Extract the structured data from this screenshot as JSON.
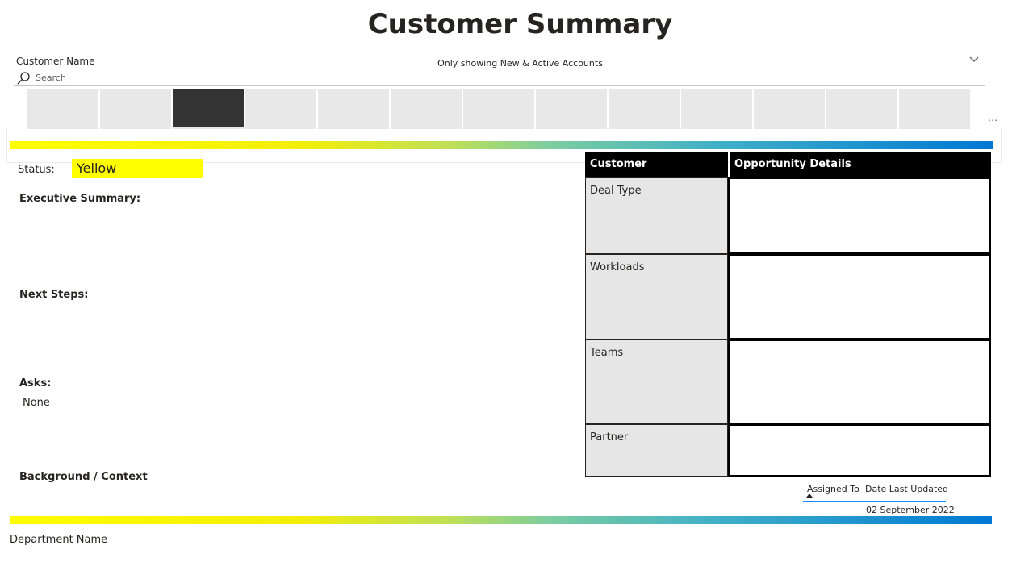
{
  "page": {
    "title": "Customer Summary",
    "department": "Department Name"
  },
  "slicer": {
    "label": "Customer Name",
    "search_placeholder": "Search",
    "filter_note": "Only showing New & Active Accounts",
    "selected_index": 2,
    "tile_count": 13
  },
  "status": {
    "label": "Status:",
    "value": "Yellow",
    "color": "#ffff00"
  },
  "sections": {
    "executive_summary": "Executive Summary:",
    "next_steps": "Next Steps:",
    "asks": "Asks:",
    "asks_value": "None",
    "background": "Background / Context"
  },
  "details_table": {
    "header_left": "Customer",
    "header_right": "Opportunity Details",
    "rows": [
      "Deal Type",
      "Workloads",
      "Teams",
      "Partner"
    ]
  },
  "footer_table": {
    "col_assigned": "Assigned To",
    "col_date": "Date Last Updated",
    "date_value": "02 September 2022"
  },
  "colors": {
    "gradient_start": "#ffff00",
    "gradient_end": "#0078d4",
    "tile": "#e8e8e8",
    "tile_selected": "#333333"
  }
}
